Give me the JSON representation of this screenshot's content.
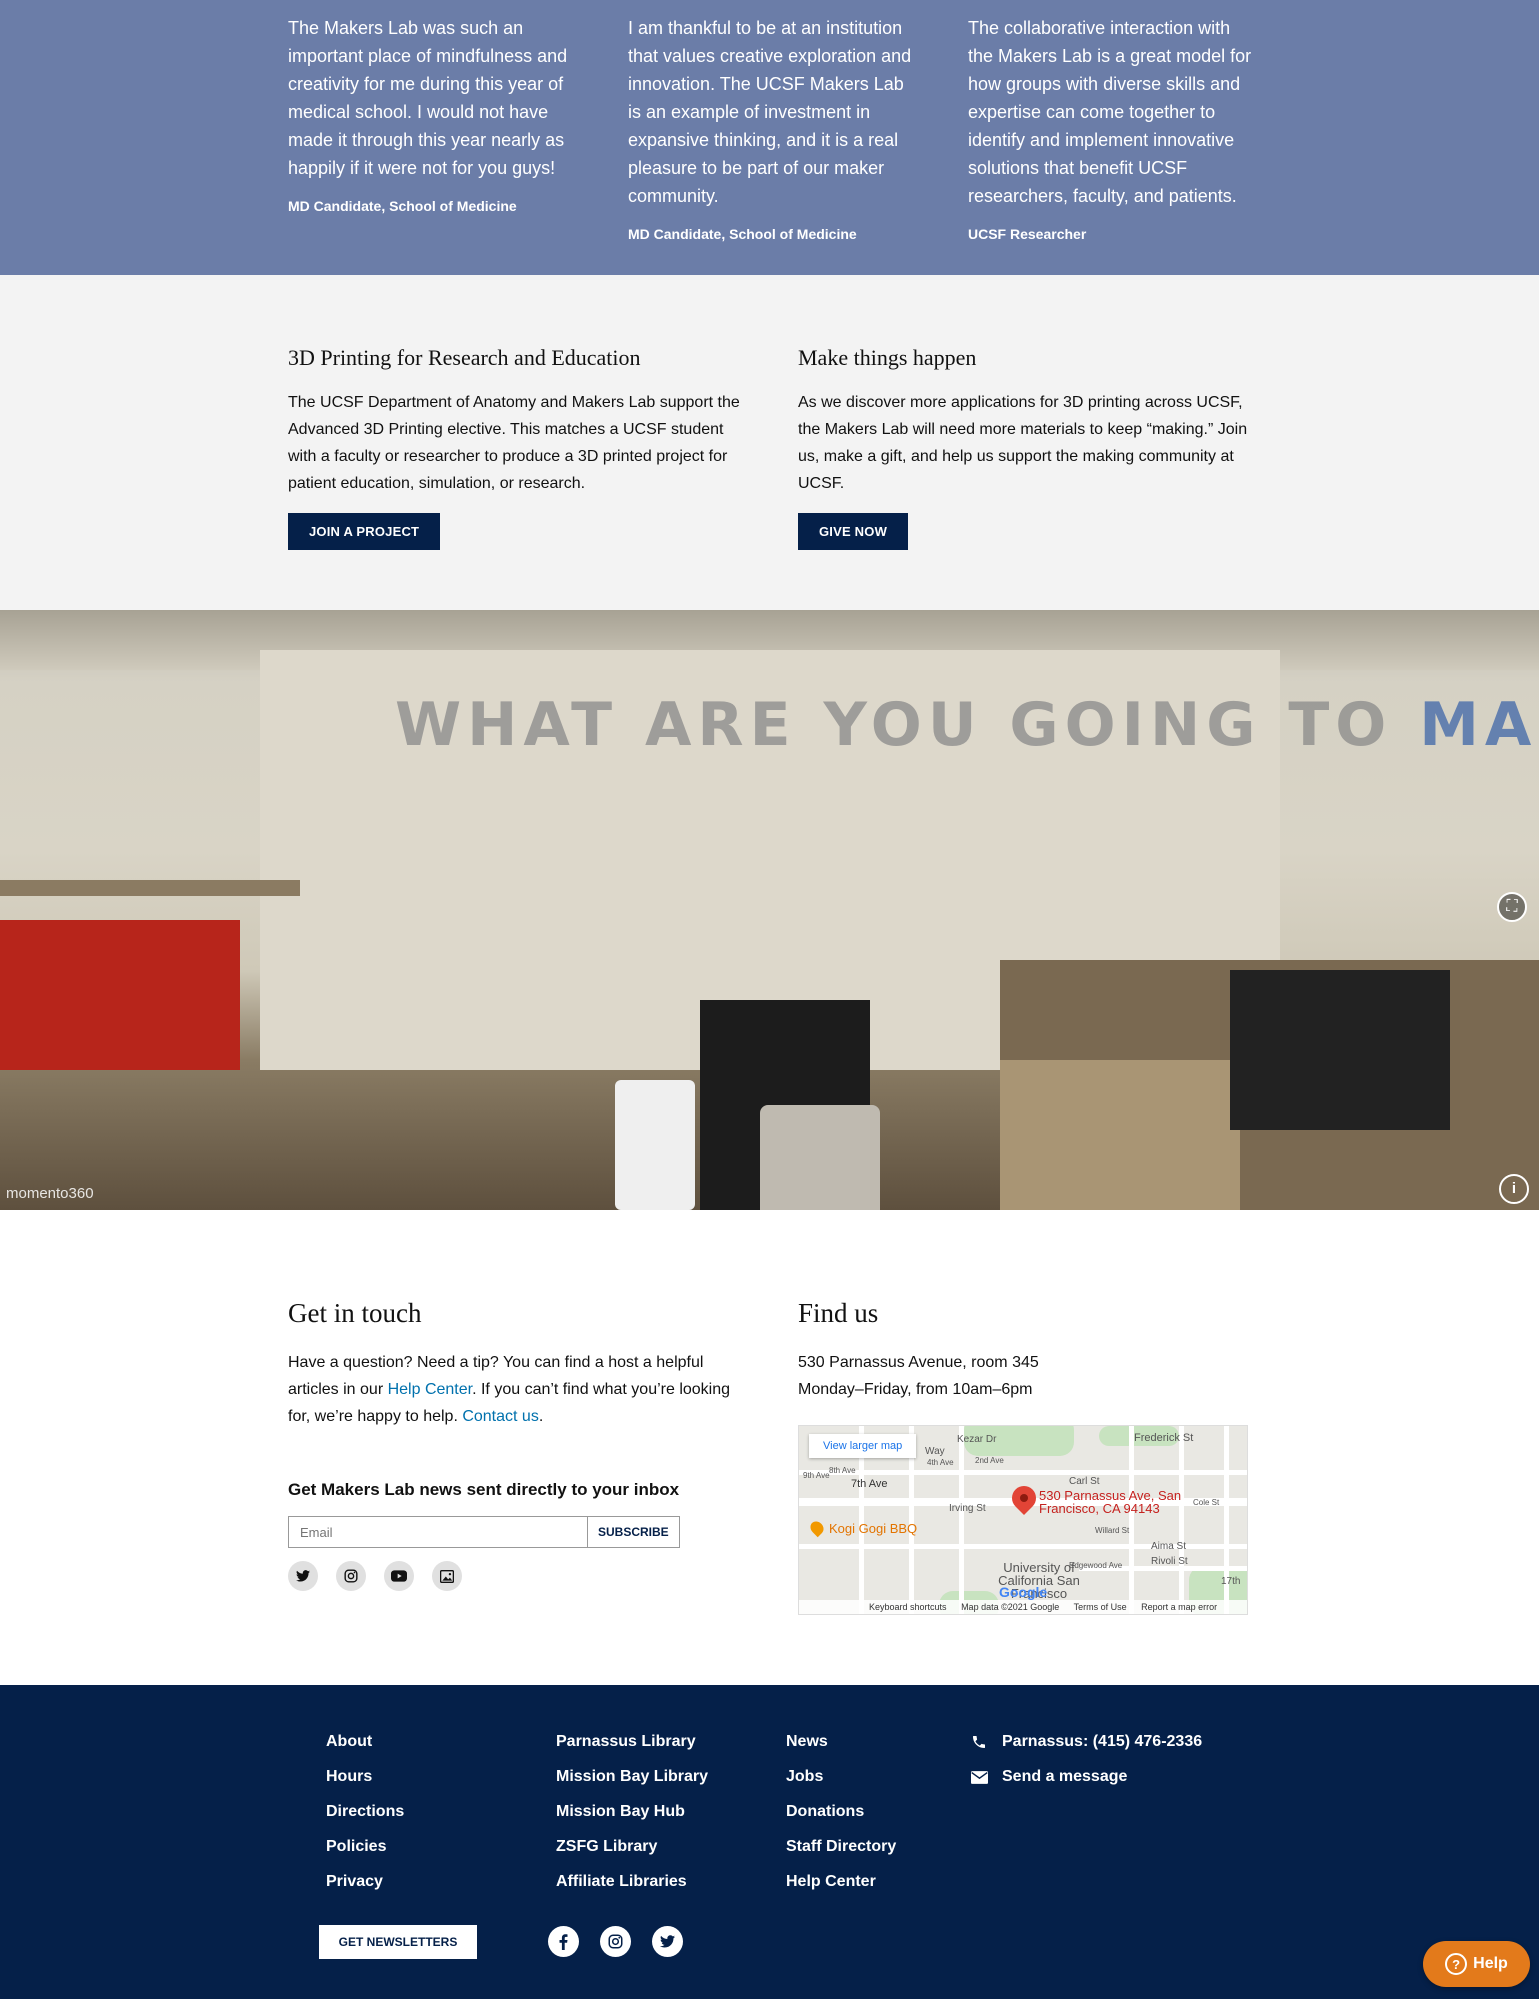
{
  "testimonials": [
    {
      "quote": "The Makers Lab was such an important place of mindfulness and creativity for me during this year of medical school. I would not have made it through this year nearly as happily if it were not for you guys!",
      "cite": "MD Candidate, School of Medicine"
    },
    {
      "quote": "I am thankful to be at an institution that values creative exploration and innovation. The UCSF Makers Lab is an example of investment in expansive thinking, and it is a real pleasure to be part of our maker community.",
      "cite": "MD Candidate, School of Medicine"
    },
    {
      "quote": "The collaborative interaction with the Makers Lab is a great model for how groups with diverse skills and expertise can come together to identify and implement innovative solutions that benefit UCSF researchers, faculty, and patients.",
      "cite": "UCSF Researcher"
    }
  ],
  "promo": {
    "left": {
      "title": "3D Printing for Research and Education",
      "body": "The UCSF Department of Anatomy and Makers Lab support the Advanced 3D Printing elective. This matches a UCSF student with a faculty or researcher to produce a 3D printed project for patient education, simulation, or research.",
      "button": "JOIN A PROJECT"
    },
    "right": {
      "title": "Make things happen",
      "body": "As we discover more applications for 3D printing across UCSF, the Makers Lab will need more materials to keep “making.” Join us, make a gift, and help us support the making community at UCSF.",
      "button": "GIVE NOW"
    }
  },
  "panorama": {
    "wall_text": "WHAT ARE YOU GOING TO",
    "wall_text_2": "MAKE?",
    "watermark": "momento360"
  },
  "contact": {
    "title": "Get in touch",
    "text_1": "Have a question? Need a tip? You can find a host a helpful articles in our ",
    "help_link": "Help Center",
    "text_2": ". If you can’t find what you’re looking for, we’re happy to help. ",
    "contact_link": "Contact us",
    "text_3": ".",
    "news_title": "Get Makers Lab news sent directly to your inbox",
    "email_placeholder": "Email",
    "subscribe_label": "SUBSCRIBE"
  },
  "find": {
    "title": "Find us",
    "address": "530 Parnassus Avenue, room 345",
    "hours": "Monday–Friday, from 10am–6pm"
  },
  "map": {
    "larger_link": "View larger map",
    "pin_label": "530 Parnassus Ave, San Francisco, CA 94143",
    "poi": "Kogi Gogi BBQ",
    "campus": "University of California San Francisco",
    "brand": "Google",
    "streets": [
      "Frederick St",
      "Carl St",
      "Irving St",
      "7th Ave",
      "9th Ave",
      "Aima St",
      "Rivoli St",
      "17th",
      "Kezar Dr",
      "Cole St",
      "Willard St",
      "Edgewood Ave",
      "2nd Ave",
      "4th Ave",
      "8th Ave",
      "Way"
    ],
    "footer": [
      "Keyboard shortcuts",
      "Map data ©2021 Google",
      "Terms of Use",
      "Report a map error"
    ]
  },
  "footer": {
    "col1": [
      "About",
      "Hours",
      "Directions",
      "Policies",
      "Privacy"
    ],
    "col2": [
      "Parnassus Library",
      "Mission Bay Library",
      "Mission Bay Hub",
      "ZSFG Library",
      "Affiliate Libraries"
    ],
    "col3": [
      "News",
      "Jobs",
      "Donations",
      "Staff Directory",
      "Help Center"
    ],
    "phone": "Parnassus: (415) 476-2336",
    "message": "Send a message",
    "newsletter_button": "GET NEWSLETTERS"
  },
  "help_widget": {
    "label": "Help"
  }
}
